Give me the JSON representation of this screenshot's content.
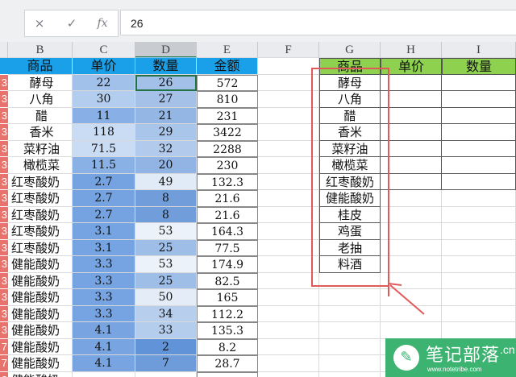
{
  "formula_bar": {
    "cancel_glyph": "×",
    "confirm_glyph": "✓",
    "fx_label": "fx",
    "value": "26"
  },
  "columns": [
    "B",
    "C",
    "D",
    "E",
    "F",
    "G",
    "H",
    "I"
  ],
  "table1": {
    "headers": [
      "商品",
      "单价",
      "数量",
      "金额"
    ],
    "row_numbers": [
      "3",
      "3",
      "3",
      "3",
      "3",
      "3",
      "3",
      "3",
      "3",
      "3",
      "3",
      "3",
      "3",
      "3",
      "3",
      "3",
      "7",
      "7",
      "3"
    ],
    "rows": [
      {
        "name": "酵母",
        "price": "22",
        "qty": "26",
        "amount": "572"
      },
      {
        "name": "八角",
        "price": "30",
        "qty": "27",
        "amount": "810"
      },
      {
        "name": "醋",
        "price": "11",
        "qty": "21",
        "amount": "231"
      },
      {
        "name": "香米",
        "price": "118",
        "qty": "29",
        "amount": "3422"
      },
      {
        "name": "菜籽油",
        "price": "71.5",
        "qty": "32",
        "amount": "2288"
      },
      {
        "name": "橄榄菜",
        "price": "11.5",
        "qty": "20",
        "amount": "230"
      },
      {
        "name": "红枣酸奶",
        "price": "2.7",
        "qty": "49",
        "amount": "132.3"
      },
      {
        "name": "红枣酸奶",
        "price": "2.7",
        "qty": "8",
        "amount": "21.6"
      },
      {
        "name": "红枣酸奶",
        "price": "2.7",
        "qty": "8",
        "amount": "21.6"
      },
      {
        "name": "红枣酸奶",
        "price": "3.1",
        "qty": "53",
        "amount": "164.3"
      },
      {
        "name": "红枣酸奶",
        "price": "3.1",
        "qty": "25",
        "amount": "77.5"
      },
      {
        "name": "健能酸奶",
        "price": "3.3",
        "qty": "53",
        "amount": "174.9"
      },
      {
        "name": "健能酸奶",
        "price": "3.3",
        "qty": "25",
        "amount": "82.5"
      },
      {
        "name": "健能酸奶",
        "price": "3.3",
        "qty": "50",
        "amount": "165"
      },
      {
        "name": "健能酸奶",
        "price": "3.3",
        "qty": "34",
        "amount": "112.2"
      },
      {
        "name": "健能酸奶",
        "price": "4.1",
        "qty": "33",
        "amount": "135.3"
      },
      {
        "name": "健能酸奶",
        "price": "4.1",
        "qty": "2",
        "amount": "8.2"
      },
      {
        "name": "健能酸奶",
        "price": "4.1",
        "qty": "7",
        "amount": "28.7"
      },
      {
        "name": "健能酸奶",
        "price": "",
        "qty": "",
        "amount": ""
      }
    ]
  },
  "table2": {
    "headers": [
      "商品",
      "单价",
      "数量"
    ],
    "items": [
      "酵母",
      "八角",
      "醋",
      "香米",
      "菜籽油",
      "橄榄菜",
      "红枣酸奶",
      "健能酸奶",
      "桂皮",
      "鸡蛋",
      "老抽",
      "料酒"
    ]
  },
  "watermark": {
    "title": "笔记部落",
    "suffix": ".cn",
    "url": "www.notetribe.com"
  },
  "colors": {
    "header_blue": "#1aa0e8",
    "header_green": "#8dd14f",
    "selection_green": "#217346",
    "annotation_red": "#e05a5a",
    "watermark_green": "#3cb371"
  }
}
